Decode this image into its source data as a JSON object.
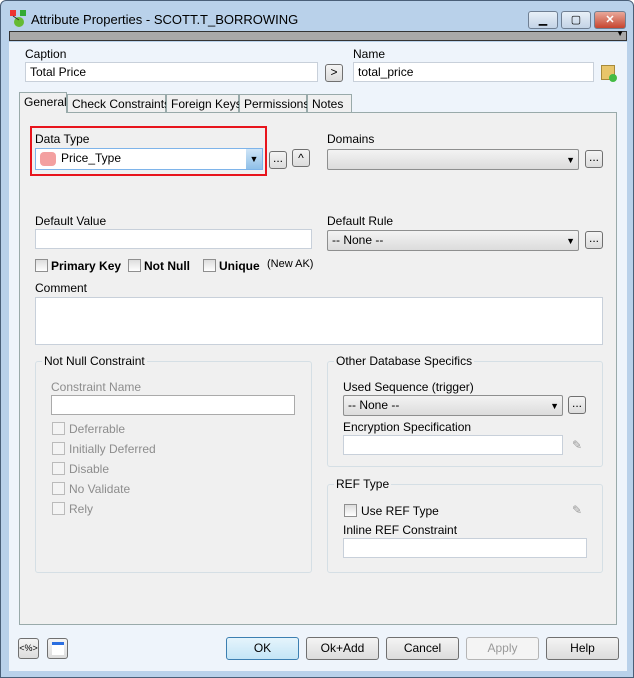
{
  "window": {
    "title": "Attribute Properties - SCOTT.T_BORROWING",
    "minimize": "▁",
    "maximize": "▢",
    "close": "✕"
  },
  "caption": {
    "label": "Caption",
    "value": "Total Price",
    "copy_button": ">"
  },
  "name": {
    "label": "Name",
    "value": "total_price"
  },
  "tabs": [
    "General",
    "Check Constraints",
    "Foreign Keys",
    "Permissions",
    "Notes"
  ],
  "general": {
    "data_type": {
      "label": "Data Type",
      "value": "Price_Type",
      "browse": "...",
      "up": "^"
    },
    "domains": {
      "label": "Domains",
      "value": "",
      "browse": "..."
    },
    "default_value": {
      "label": "Default Value",
      "value": ""
    },
    "default_rule": {
      "label": "Default Rule",
      "value": "-- None --",
      "browse": "..."
    },
    "checks": {
      "primary_key": "Primary Key",
      "not_null": "Not Null",
      "unique": "Unique",
      "new_ak": "(New AK)"
    },
    "comment": {
      "label": "Comment",
      "value": ""
    },
    "not_null_constraint": {
      "title": "Not Null Constraint",
      "constraint_name_label": "Constraint Name",
      "constraint_name": "",
      "options": [
        "Deferrable",
        "Initially Deferred",
        "Disable",
        "No Validate",
        "Rely"
      ]
    },
    "other_db": {
      "title": "Other Database Specifics",
      "used_sequence_label": "Used Sequence (trigger)",
      "used_sequence": "-- None --",
      "browse": "...",
      "encryption_label": "Encryption Specification",
      "encryption": ""
    },
    "ref_type": {
      "title": "REF Type",
      "use_ref_type": "Use REF Type",
      "inline_label": "Inline REF Constraint",
      "inline": ""
    }
  },
  "footer": {
    "macro_button": "<%>",
    "ok": "OK",
    "ok_add": "Ok+Add",
    "cancel": "Cancel",
    "apply": "Apply",
    "help": "Help"
  },
  "colors": {
    "highlight": "#e8141c",
    "window_frame": "#b9d1ea"
  }
}
